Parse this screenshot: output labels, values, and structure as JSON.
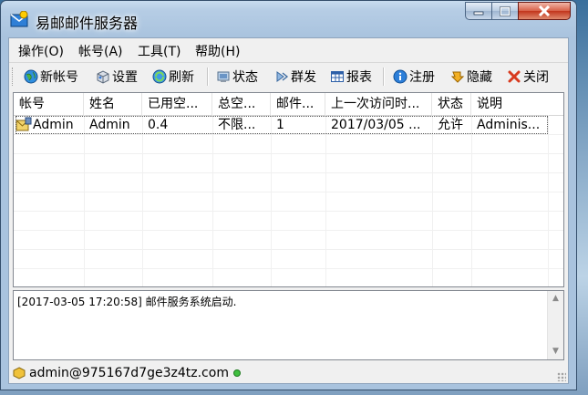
{
  "window": {
    "title": "易邮邮件服务器"
  },
  "menu": {
    "items": [
      "操作(O)",
      "帐号(A)",
      "工具(T)",
      "帮助(H)"
    ]
  },
  "toolbar": {
    "new_account": "新帐号",
    "settings": "设置",
    "refresh": "刷新",
    "status": "状态",
    "broadcast": "群发",
    "report": "报表",
    "register": "注册",
    "hide": "隐藏",
    "close": "关闭"
  },
  "accounts": {
    "columns": [
      "帐号",
      "姓名",
      "已用空...",
      "总空...",
      "邮件...",
      "上一次访问时...",
      "状态",
      "说明"
    ],
    "rows": [
      [
        "Admin",
        "Admin",
        "0.4",
        "不限...",
        "1",
        "2017/03/05 ...",
        "允许",
        "Adminis..."
      ]
    ]
  },
  "log": {
    "lines": [
      "[2017-03-05 17:20:58] 邮件服务系统启动."
    ]
  },
  "status": {
    "account": "admin@975167d7ge3z4tz.com"
  },
  "colors": {
    "title_glass": "#a9c3de",
    "close_red": "#c2351c",
    "client_bg": "#f0f0f0"
  }
}
